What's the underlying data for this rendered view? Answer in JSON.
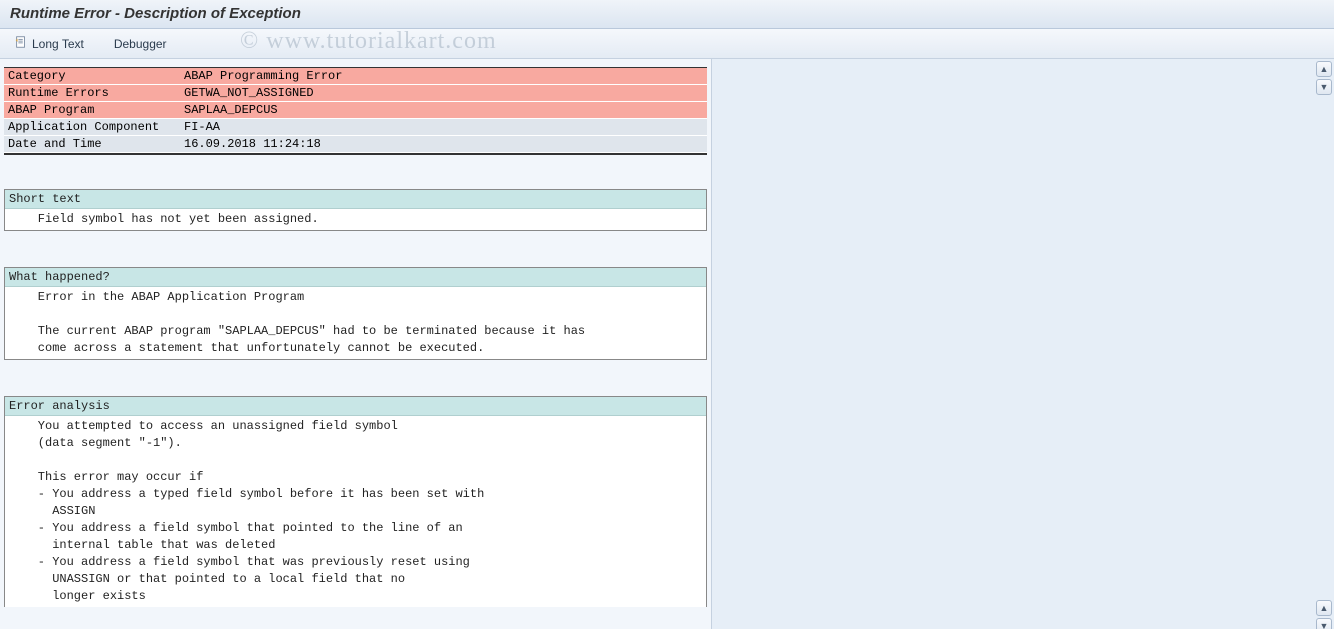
{
  "title": "Runtime Error - Description of Exception",
  "toolbar": {
    "long_text": "Long Text",
    "debugger": "Debugger"
  },
  "watermark": "© www.tutorialkart.com",
  "header": {
    "rows": [
      {
        "label": "Category",
        "value": "ABAP Programming Error",
        "red": true
      },
      {
        "label": "Runtime Errors",
        "value": "GETWA_NOT_ASSIGNED",
        "red": true
      },
      {
        "label": "ABAP Program",
        "value": "SAPLAA_DEPCUS",
        "red": true
      },
      {
        "label": "Application Component",
        "value": "FI-AA",
        "red": false
      },
      {
        "label": "Date and Time",
        "value": "16.09.2018 11:24:18",
        "red": false
      }
    ]
  },
  "sections": [
    {
      "title": "Short text",
      "lines": [
        "    Field symbol has not yet been assigned."
      ]
    },
    {
      "title": "What happened?",
      "lines": [
        "    Error in the ABAP Application Program",
        "",
        "    The current ABAP program \"SAPLAA_DEPCUS\" had to be terminated because it has",
        "    come across a statement that unfortunately cannot be executed."
      ]
    },
    {
      "title": "Error analysis",
      "lines": [
        "    You attempted to access an unassigned field symbol",
        "    (data segment \"-1\").",
        "",
        "    This error may occur if",
        "    - You address a typed field symbol before it has been set with",
        "      ASSIGN",
        "    - You address a field symbol that pointed to the line of an",
        "      internal table that was deleted",
        "    - You address a field symbol that was previously reset using",
        "      UNASSIGN or that pointed to a local field that no",
        "      longer exists"
      ]
    }
  ]
}
